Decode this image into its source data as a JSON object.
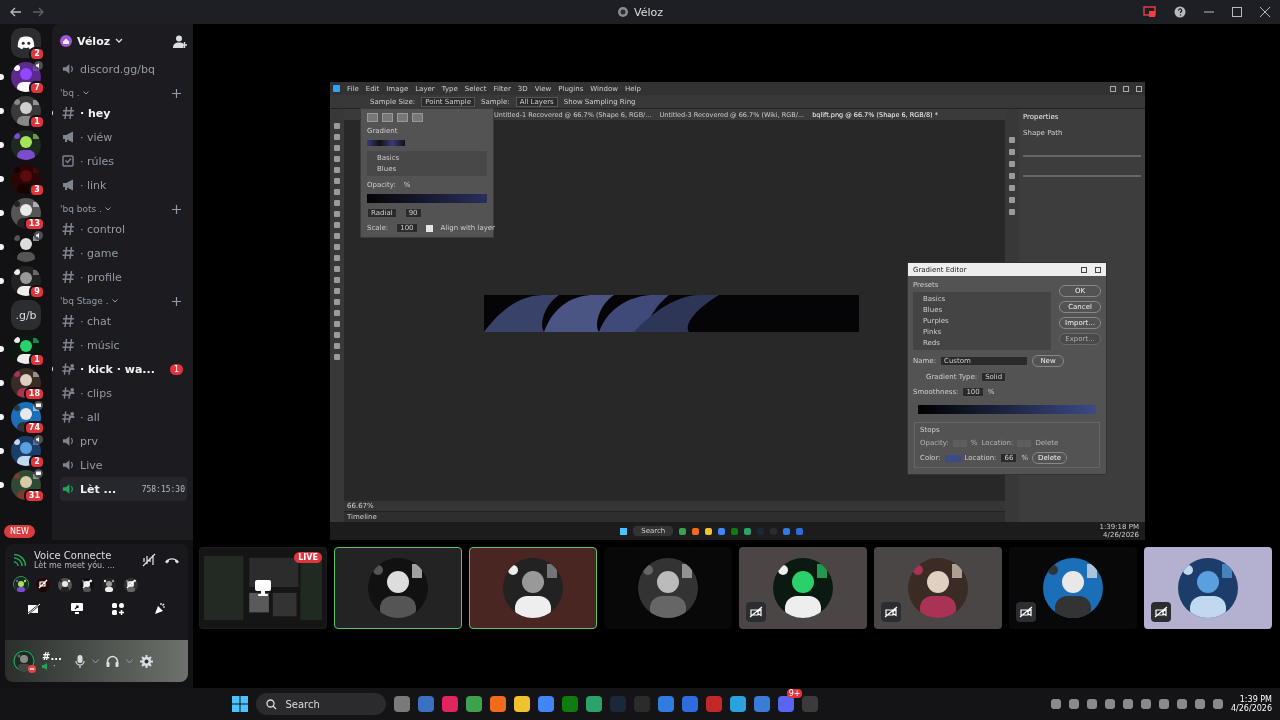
{
  "window": {
    "title": "Véloz"
  },
  "rail": {
    "new_label": "NEW",
    "servers": [
      {
        "kind": "home",
        "badge": "2",
        "unread": false,
        "voice": false,
        "video": false
      },
      {
        "kind": "picture",
        "badge": "7",
        "unread": true,
        "voice": true,
        "video": false
      },
      {
        "kind": "picture",
        "badge": "1",
        "unread": true,
        "voice": false,
        "video": false
      },
      {
        "kind": "picture",
        "unread": true,
        "voice": false,
        "video": false
      },
      {
        "kind": "picture",
        "badge": "3",
        "unread": true,
        "voice": false,
        "video": false
      },
      {
        "kind": "picture",
        "badge": "13",
        "unread": true,
        "voice": false,
        "video": false
      },
      {
        "kind": "picture",
        "unread": true,
        "voice": true,
        "video": false
      },
      {
        "kind": "picture",
        "badge": "9",
        "unread": true,
        "voice": false,
        "video": false
      },
      {
        "kind": "label",
        "label": ".g/b",
        "unread": false,
        "voice": false,
        "video": false
      },
      {
        "kind": "picture",
        "badge": "1",
        "unread": true,
        "voice": false,
        "video": false
      },
      {
        "kind": "picture",
        "badge": "18",
        "unread": true,
        "voice": false,
        "video": false
      },
      {
        "kind": "picture",
        "badge": "74",
        "unread": true,
        "voice": false,
        "video": true
      },
      {
        "kind": "picture",
        "badge": "2",
        "unread": true,
        "voice": true,
        "video": false
      },
      {
        "kind": "picture",
        "badge": "31",
        "unread": true,
        "voice": false,
        "video": true
      }
    ]
  },
  "server": {
    "name": "Véloz",
    "invite": "discord.gg/bq"
  },
  "categories": [
    {
      "name": "'bq .",
      "channels": [
        {
          "kind": "text",
          "name": "· hey",
          "unread": true
        },
        {
          "kind": "announce",
          "name": "· viéw",
          "unread": false
        },
        {
          "kind": "rules",
          "name": "· rúles",
          "unread": false
        },
        {
          "kind": "announce",
          "name": "· link",
          "unread": false
        }
      ]
    },
    {
      "name": "'bq bots .",
      "channels": [
        {
          "kind": "text",
          "name": "· control",
          "unread": false
        },
        {
          "kind": "text",
          "name": "· game",
          "unread": false
        },
        {
          "kind": "text",
          "name": "· profile",
          "unread": false
        }
      ]
    },
    {
      "name": "'bq Stage .",
      "channels": [
        {
          "kind": "text",
          "name": "· chat",
          "unread": false
        },
        {
          "kind": "text",
          "name": "· músic",
          "unread": false
        },
        {
          "kind": "text-limited",
          "name": "· kick · wa...",
          "unread": true,
          "badge": "1"
        },
        {
          "kind": "text-limited",
          "name": "· clips",
          "unread": false
        },
        {
          "kind": "text-limited",
          "name": "· all",
          "unread": false
        }
      ]
    }
  ],
  "voice_channels": [
    {
      "name": "prv",
      "connected": false
    },
    {
      "name": "Live",
      "connected": false
    },
    {
      "name": "Lèt ...",
      "connected": true,
      "timer": "758:15:30"
    }
  ],
  "voice_panel": {
    "status": "Voice Connecte",
    "channel": "Lèt me meet yóu. ...",
    "members": [
      {
        "speaking": true,
        "muted": false
      },
      {
        "speaking": false,
        "muted": true
      },
      {
        "speaking": false,
        "muted": false
      },
      {
        "speaking": false,
        "muted": true
      },
      {
        "speaking": false,
        "muted": false
      },
      {
        "speaking": false,
        "muted": true
      }
    ]
  },
  "user": {
    "name": "#...",
    "status": "·"
  },
  "stream": {
    "menu": [
      "File",
      "Edit",
      "Image",
      "Layer",
      "Type",
      "Select",
      "Filter",
      "3D",
      "View",
      "Plugins",
      "Window",
      "Help"
    ],
    "options": [
      "Sample Size:",
      "Point Sample",
      "Sample:",
      "All Layers",
      "Show Sampling Ring"
    ],
    "tabs": [
      "Untitled-1 Recovered @ 66.7% (Shape 6, RGB/...",
      "Untitled-3 Recovered @ 66.7% (Wiki, RGB/...",
      "bqlift.png @ 66.7% (Shape 6, RGB/8) *"
    ],
    "gradient_panel": {
      "title": "Gradient",
      "folders": [
        "Basics",
        "Blues"
      ],
      "opacity_label": "Opacity:",
      "unit": "%",
      "style": "Radial",
      "angle": "90",
      "scale_label": "Scale:",
      "scale": "100",
      "align": "Align with layer",
      "align_checked": true
    },
    "dialog": {
      "title": "Gradient Editor",
      "presets_label": "Presets",
      "presets": [
        "Basics",
        "Blues",
        "Purples",
        "Pinks",
        "Reds"
      ],
      "buttons": [
        {
          "label": "OK",
          "disabled": false
        },
        {
          "label": "Cancel",
          "disabled": false
        },
        {
          "label": "Import...",
          "disabled": false
        },
        {
          "label": "Export...",
          "disabled": true
        }
      ],
      "name_label": "Name:",
      "name": "Custom",
      "new": "New",
      "type_label": "Gradient Type:",
      "type": "Solid",
      "smoothness_label": "Smoothness:",
      "smoothness": "100",
      "smoothness_unit": "%",
      "stops_label": "Stops",
      "opacity_label": "Opacity:",
      "opacity_unit": "%",
      "opacity_location_label": "Location:",
      "opacity_delete": "Delete",
      "color_label": "Color:",
      "color_location_label": "Location:",
      "location": "66",
      "location_unit": "%",
      "color_delete": "Delete"
    },
    "properties": {
      "title": "Properties",
      "items": [
        "Shape Path"
      ]
    },
    "zoom": "66.67%",
    "timeline": "Timeline",
    "taskbar": {
      "search": "Search",
      "time": "1:39:18 PM",
      "date": "4/26/2026"
    }
  },
  "tiles": [
    {
      "kind": "screen",
      "badge": "LIVE",
      "speaking": false,
      "muted": false,
      "color": "#1c1c1c"
    },
    {
      "kind": "avatar",
      "speaking": true,
      "muted": false,
      "color": "#232323"
    },
    {
      "kind": "avatar",
      "speaking": true,
      "muted": false,
      "color": "#4a2622"
    },
    {
      "kind": "avatar",
      "speaking": false,
      "muted": false,
      "color": "#080808"
    },
    {
      "kind": "avatar",
      "speaking": false,
      "muted": true,
      "color": "#4b4645"
    },
    {
      "kind": "avatar",
      "speaking": false,
      "muted": true,
      "color": "#4a4645"
    },
    {
      "kind": "avatar",
      "speaking": false,
      "muted": true,
      "color": "#080808"
    },
    {
      "kind": "avatar",
      "speaking": false,
      "muted": true,
      "color": "#b3b1cf"
    }
  ],
  "taskbar": {
    "search": "Search",
    "time": "1:39 PM",
    "date": "4/26/2026",
    "discord_badge": "9+",
    "apps": [
      {
        "kind": "files"
      },
      {
        "kind": "calculator"
      },
      {
        "kind": "media"
      },
      {
        "kind": "sync"
      },
      {
        "kind": "bolt"
      },
      {
        "kind": "folder"
      },
      {
        "kind": "browser"
      },
      {
        "kind": "xbox"
      },
      {
        "kind": "grid"
      },
      {
        "kind": "steam"
      },
      {
        "kind": "epic"
      },
      {
        "kind": "mountain"
      },
      {
        "kind": "capture"
      },
      {
        "kind": "voice"
      },
      {
        "kind": "telegram"
      },
      {
        "kind": "monitor"
      },
      {
        "kind": "discord"
      },
      {
        "kind": "obs"
      }
    ]
  }
}
